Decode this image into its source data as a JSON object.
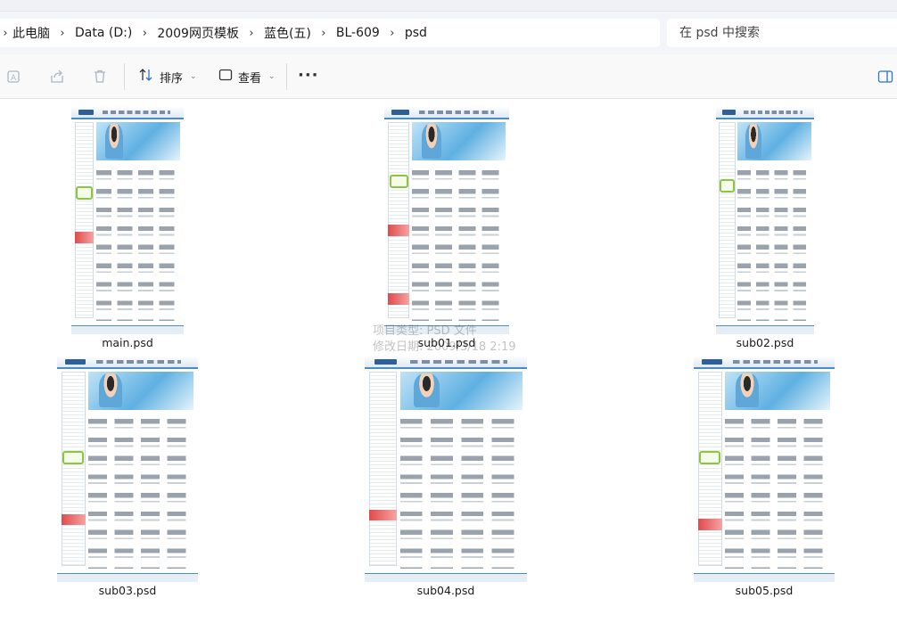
{
  "breadcrumb": [
    "此电脑",
    "Data (D:)",
    "2009网页模板",
    "蓝色(五)",
    "BL-609",
    "psd"
  ],
  "search": {
    "placeholder": "在 psd 中搜索"
  },
  "toolbar": {
    "sort_label": "排序",
    "view_label": "查看",
    "more_label": "···"
  },
  "files": [
    {
      "name": "main.psd"
    },
    {
      "name": "sub01.psd"
    },
    {
      "name": "sub02.psd"
    },
    {
      "name": "sub03.psd"
    },
    {
      "name": "sub04.psd"
    },
    {
      "name": "sub05.psd"
    }
  ],
  "tooltip": {
    "line1": "项目类型: PSD 文件",
    "line2": "修改日期: 2009/3/18 2:19"
  },
  "colors": {
    "accent": "#4b8cc7",
    "selection_green": "#8cc63f",
    "sale_red": "#e04b4b"
  },
  "icons": [
    "rename-icon",
    "share-icon",
    "delete-icon",
    "sort-icon",
    "view-icon",
    "details-pane-icon",
    "chevron-right-icon"
  ]
}
